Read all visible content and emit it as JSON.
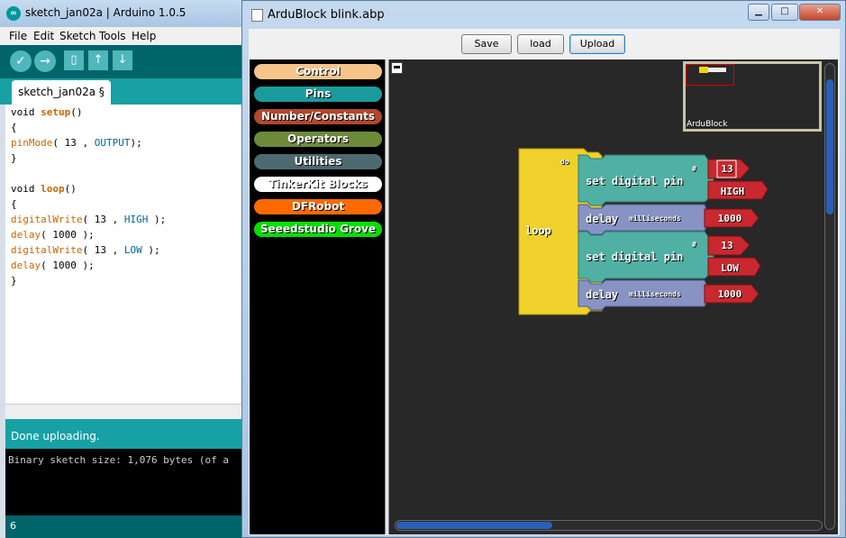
{
  "ide": {
    "title": "sketch_jan02a | Arduino 1.0.5",
    "menu": [
      "File",
      "Edit",
      "Sketch",
      "Tools",
      "Help"
    ],
    "tab_label": "sketch_jan02a §",
    "status": "Done uploading.",
    "console": "Binary sketch size: 1,076 bytes (of a",
    "line_number": "6",
    "code": {
      "setup_kw": "void",
      "setup_fn": "setup",
      "setup_paren": "()",
      "brace_open1": "{",
      "pinmode_fn": "pinMode",
      "pinmode_args": "( 13 , ",
      "pinmode_const": "OUTPUT",
      "pinmode_end": ");",
      "brace_close1": "}",
      "loop_kw": "void",
      "loop_fn": "loop",
      "loop_paren": "()",
      "brace_open2": "{",
      "dw1_fn": "digitalWrite",
      "dw1_args": "( 13 , ",
      "dw1_const": "HIGH",
      "dw1_end": " );",
      "delay1_fn": "delay",
      "delay1_args": "( 1000 );",
      "dw2_fn": "digitalWrite",
      "dw2_args": "( 13 , ",
      "dw2_const": "LOW",
      "dw2_end": " );",
      "delay2_fn": "delay",
      "delay2_args": "( 1000 );",
      "brace_close2": "}"
    }
  },
  "ardublock": {
    "title": "ArduBlock blink.abp",
    "buttons": {
      "save": "Save",
      "load": "load",
      "upload": "Upload"
    },
    "categories": [
      {
        "label": "Control",
        "color": "#f7c58a"
      },
      {
        "label": "Pins",
        "color": "#1a9b9d"
      },
      {
        "label": "Number/Constants",
        "color": "#b2472a"
      },
      {
        "label": "Operators",
        "color": "#6d8a3a"
      },
      {
        "label": "Utilities",
        "color": "#4d6a70"
      },
      {
        "label": "TinkerKit Blocks",
        "color": "#ffffff"
      },
      {
        "label": "DFRobot",
        "color": "#ff6a00"
      },
      {
        "label": "Seeedstudio Grove",
        "color": "#00e000"
      }
    ],
    "minimap_label": "ArduBlock",
    "blocks": {
      "loop_label": "loop",
      "do_label": "do",
      "set1_label": "set digital pin",
      "set1_hash": "#",
      "set1_pin": "13",
      "set1_value": "HIGH",
      "delay1_label": "delay",
      "delay1_unit": "milliseconds",
      "delay1_value": "1000",
      "set2_label": "set digital pin",
      "set2_hash": "#",
      "set2_pin": "13",
      "set2_value": "LOW",
      "delay2_label": "delay",
      "delay2_unit": "milliseconds",
      "delay2_value": "1000"
    }
  }
}
